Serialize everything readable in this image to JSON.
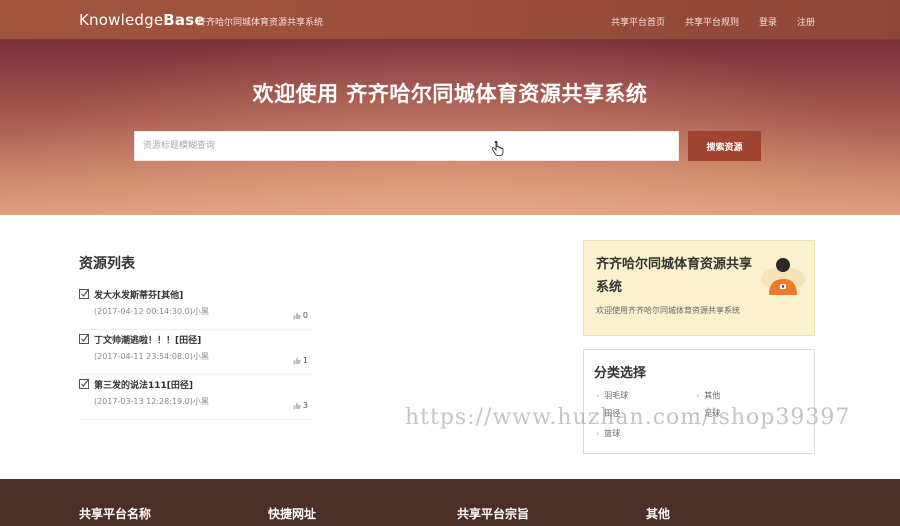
{
  "header": {
    "logo_light": "Knowledge",
    "logo_bold": "Base",
    "subtitle": "齐齐哈尔同城体育资源共享系统",
    "nav": [
      "共享平台首页",
      "共享平台规则",
      "登录",
      "注册"
    ]
  },
  "hero": {
    "title": "欢迎使用 齐齐哈尔同城体育资源共享系统",
    "search_placeholder": "资源标题模糊查询",
    "search_button": "搜索资源"
  },
  "resource_list": {
    "title": "资源列表",
    "items": [
      {
        "name": "发大水发斯蒂芬[其他]",
        "meta": "(2017-04-12 00:14:30.0)小黑",
        "likes": "0"
      },
      {
        "name": "丁文帅潮逃啦！！！[田径]",
        "meta": "(2017-04-11 23:54:08.0)小黑",
        "likes": "1"
      },
      {
        "name": "第三发的说法111[田径]",
        "meta": "(2017-03-13 12:28:19.0)小黑",
        "likes": "3"
      }
    ]
  },
  "welcome_card": {
    "title": "齐齐哈尔同城体育资源共享系统",
    "text": "欢迎使用齐齐哈尔同城体育资源共享系统"
  },
  "category_card": {
    "title": "分类选择",
    "items": [
      "羽毛球",
      "其他",
      "田径",
      "足球",
      "篮球"
    ]
  },
  "watermark": "https://www.huzhan.com/ishop39397",
  "footer": {
    "columns": [
      "共享平台名称",
      "快捷网址",
      "共享平台宗旨",
      "其他"
    ]
  },
  "colors": {
    "header": "#9b4e3b",
    "accent": "#a04330",
    "footer": "#4a2f24",
    "card": "#fbf1cf"
  }
}
